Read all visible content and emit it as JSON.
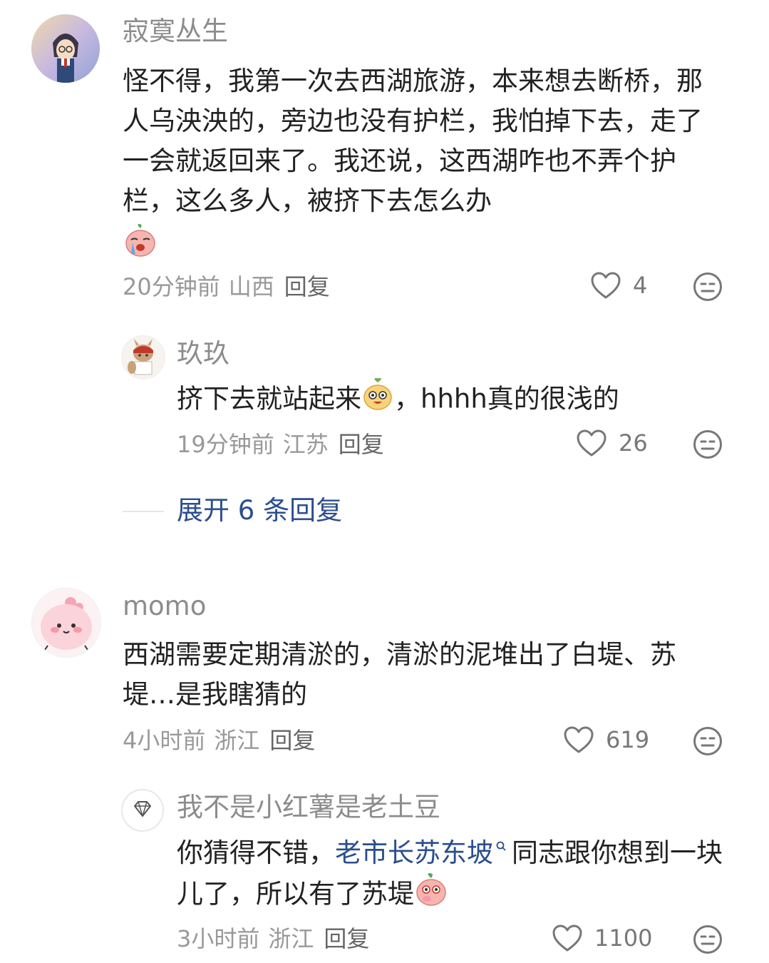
{
  "comments": [
    {
      "username": "寂寞丛生",
      "text_parts": [
        "怪不得，我第一次去西湖旅游，本来想去断桥，那人乌泱泱的，旁边也没有护栏，我怕掉下去，走了一会就返回来了。我还说，这西湖咋也不弄个护栏，这么多人，被挤下去怎么办"
      ],
      "emoji": "crying-peach-emoji",
      "time": "20分钟前",
      "location": "山西",
      "reply_label": "回复",
      "likes": "4",
      "replies": [
        {
          "username": "玖玖",
          "text_before": "挤下去就站起来",
          "emoji": "laughing-peach-emoji",
          "text_after": "，hhhh真的很浅的",
          "time": "19分钟前",
          "location": "江苏",
          "reply_label": "回复",
          "likes": "26"
        }
      ],
      "expand_label": "展开 6 条回复"
    },
    {
      "username": "momo",
      "text": "西湖需要定期清淤的，清淤的泥堆出了白堤、苏堤…是我瞎猜的",
      "time": "4小时前",
      "location": "浙江",
      "reply_label": "回复",
      "likes": "619",
      "replies": [
        {
          "username": "我不是小红薯是老土豆",
          "text_before": "你猜得不错，",
          "link_text": "老市长苏东坡",
          "text_after": "同志跟你想到一块儿了，所以有了苏堤",
          "emoji": "thinking-peach-emoji",
          "time": "3小时前",
          "location": "浙江",
          "reply_label": "回复",
          "likes": "1100"
        }
      ]
    }
  ],
  "colors": {
    "username": "#8c8c8c",
    "body": "#222222",
    "meta": "#999999",
    "link": "#2a4e8e",
    "icon": "#777777"
  }
}
